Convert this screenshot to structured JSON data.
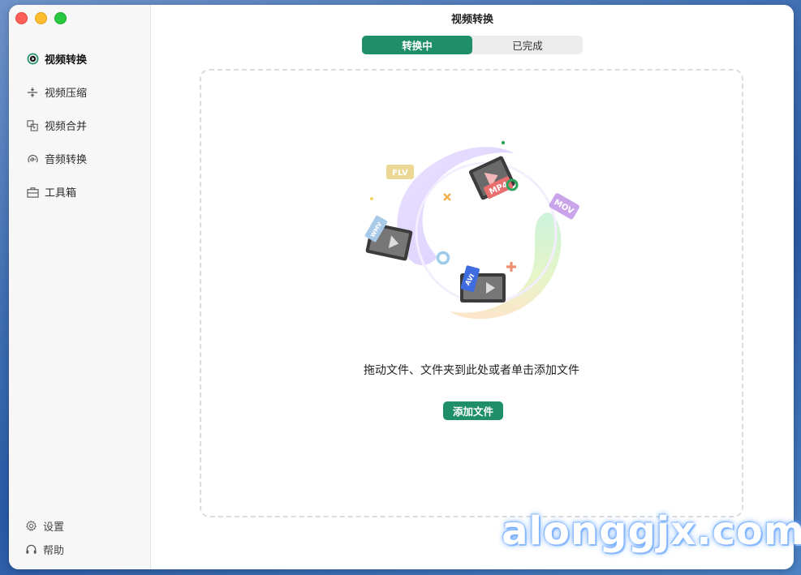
{
  "window": {
    "title": "视频转换"
  },
  "sidebar": {
    "items": [
      {
        "label": "视频转换",
        "icon": "convert-icon",
        "active": true
      },
      {
        "label": "视频压缩",
        "icon": "compress-icon",
        "active": false
      },
      {
        "label": "视频合并",
        "icon": "merge-icon",
        "active": false
      },
      {
        "label": "音频转换",
        "icon": "audio-icon",
        "active": false
      },
      {
        "label": "工具箱",
        "icon": "toolbox-icon",
        "active": false
      }
    ],
    "bottom": [
      {
        "label": "设置",
        "icon": "gear-icon"
      },
      {
        "label": "帮助",
        "icon": "headset-icon"
      }
    ]
  },
  "tabs": [
    {
      "label": "转换中",
      "active": true
    },
    {
      "label": "已完成",
      "active": false
    }
  ],
  "dropzone": {
    "text": "拖动文件、文件夹到此处或者单击添加文件",
    "button": "添加文件",
    "formats": [
      "FLV",
      "MP4",
      "MOV",
      "WMV",
      "AVI"
    ]
  },
  "watermark": "alonggjx.com",
  "colors": {
    "accent": "#1f8f6a",
    "sidebar_bg": "#f7f7f7"
  }
}
